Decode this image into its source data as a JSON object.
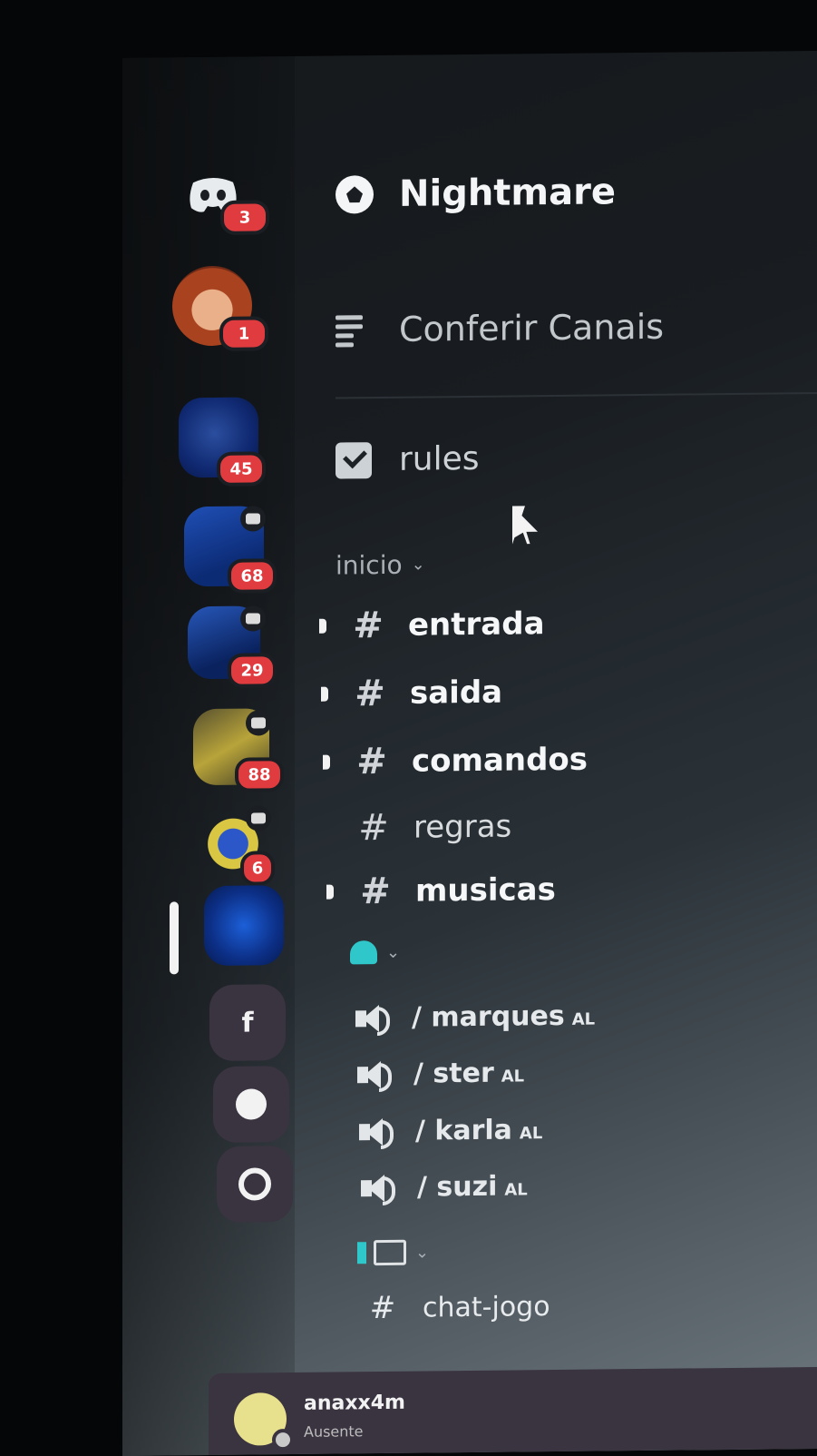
{
  "server": {
    "name": "Nightmare"
  },
  "nav": {
    "browse_label": "Conferir Canais",
    "rules_label": "rules"
  },
  "categories": {
    "inicio": {
      "label": "inicio",
      "channels": [
        {
          "name": "entrada",
          "unread": true
        },
        {
          "name": "saida",
          "unread": true
        },
        {
          "name": "comandos",
          "unread": true
        },
        {
          "name": "regras",
          "unread": false
        },
        {
          "name": "musicas",
          "unread": true
        }
      ]
    },
    "voice": {
      "channels": [
        {
          "name": "/ marques",
          "tag": "AL"
        },
        {
          "name": "/ ster",
          "tag": "AL"
        },
        {
          "name": "/ karla",
          "tag": "AL"
        },
        {
          "name": "/ suzi",
          "tag": "AL"
        }
      ]
    },
    "games": {
      "channels": [
        {
          "name": "chat-jogo"
        }
      ]
    }
  },
  "rail": {
    "badges": [
      "3",
      "1",
      "45",
      "68",
      "29",
      "88",
      "6"
    ],
    "folder_letter": "f"
  },
  "user": {
    "name": "anaxx4m",
    "status": "Ausente"
  },
  "colors": {
    "badge": "#e03b3f",
    "rail_ghost": "#3a3340",
    "accent_teal": "#2fc7c9"
  }
}
